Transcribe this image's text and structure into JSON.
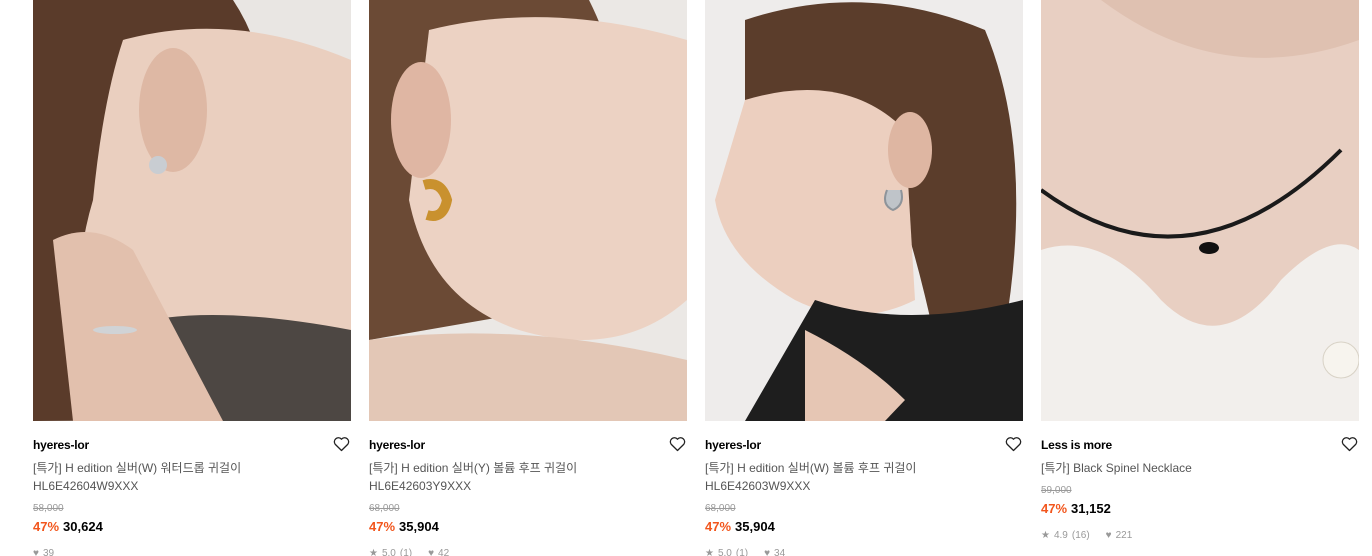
{
  "products": [
    {
      "brand": "hyeres-lor",
      "name_line1": "[특가] H edition 실버(W) 워터드롭 귀걸이",
      "name_line2": "HL6E42604W9XXX",
      "original_price": "58,000",
      "discount": "47%",
      "price": "30,624",
      "rating": "",
      "review_count": "",
      "likes": "39",
      "photo_desc_icon": "earring-model-photo"
    },
    {
      "brand": "hyeres-lor",
      "name_line1": "[특가] H edition 실버(Y) 볼륨 후프 귀걸이",
      "name_line2": "HL6E42603Y9XXX",
      "original_price": "68,000",
      "discount": "47%",
      "price": "35,904",
      "rating": "5.0",
      "review_count": "(1)",
      "likes": "42",
      "photo_desc_icon": "earring-model-photo"
    },
    {
      "brand": "hyeres-lor",
      "name_line1": "[특가] H edition 실버(W) 볼륨 후프 귀걸이",
      "name_line2": "HL6E42603W9XXX",
      "original_price": "68,000",
      "discount": "47%",
      "price": "35,904",
      "rating": "5.0",
      "review_count": "(1)",
      "likes": "34",
      "photo_desc_icon": "earring-model-photo"
    },
    {
      "brand": "Less is more",
      "name_line1": "[특가] Black Spinel Necklace",
      "name_line2": "",
      "original_price": "59,000",
      "discount": "47%",
      "price": "31,152",
      "rating": "4.9",
      "review_count": "(16)",
      "likes": "221",
      "photo_desc_icon": "necklace-model-photo"
    }
  ],
  "colors": {
    "discount": "#f2561d",
    "muted": "#999999"
  }
}
